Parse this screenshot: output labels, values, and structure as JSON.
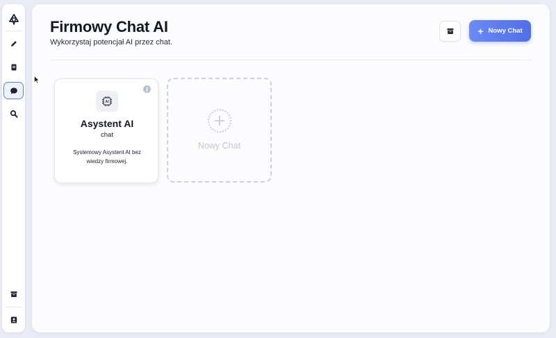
{
  "header": {
    "title": "Firmowy Chat AI",
    "subtitle": "Wykorzystaj potencjał AI przez chat.",
    "new_chat_label": "Nowy Chat",
    "archive_icon": "archive-icon"
  },
  "sidebar": {
    "items": [
      {
        "icon": "logo-icon"
      },
      {
        "icon": "pencil-icon"
      },
      {
        "icon": "document-icon"
      },
      {
        "icon": "chat-bubble-icon",
        "active": true
      },
      {
        "icon": "search-icon"
      },
      {
        "icon": "archive-icon"
      },
      {
        "icon": "contact-book-icon"
      }
    ]
  },
  "cards": [
    {
      "icon": "ai-chip-icon",
      "chip_text": "AI",
      "title": "Asystent AI",
      "type": "chat",
      "description": "Systemowy Asystent AI bez wiedzy firmowej."
    }
  ],
  "add_card": {
    "label": "Nowy Chat"
  },
  "colors": {
    "accent": "#5b7cf0",
    "accent_gradient_start": "#6b8af5",
    "accent_gradient_end": "#4f6ee8",
    "background": "#e9ecf4",
    "panel": "#fcfcfe"
  }
}
